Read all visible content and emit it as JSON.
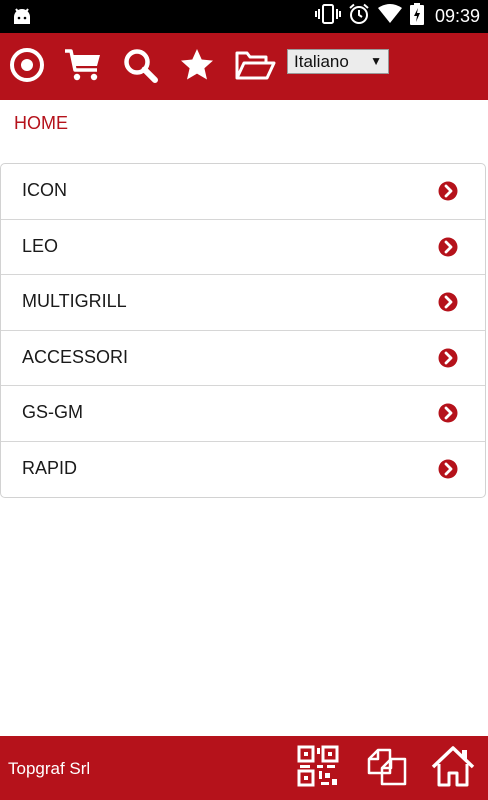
{
  "status_bar": {
    "time": "09:39",
    "icons": [
      "android-icon",
      "vibrate-icon",
      "alarm-icon",
      "wifi-icon",
      "battery-charging-icon"
    ]
  },
  "toolbar": {
    "icons": [
      "target-icon",
      "cart-icon",
      "search-icon",
      "star-icon",
      "folder-open-icon"
    ],
    "language": {
      "selected": "Italiano"
    }
  },
  "breadcrumb": {
    "home": "HOME"
  },
  "menu": {
    "items": [
      {
        "label": "ICON"
      },
      {
        "label": "LEO"
      },
      {
        "label": "MULTIGRILL"
      },
      {
        "label": "ACCESSORI"
      },
      {
        "label": "GS-GM"
      },
      {
        "label": "RAPID"
      }
    ],
    "chevron_icon": "chevron-circle-right-icon"
  },
  "footer": {
    "company": "Topgraf Srl",
    "icons": [
      "qr-code-icon",
      "copy-icon",
      "home-icon"
    ]
  },
  "colors": {
    "brand_red": "#b5121b",
    "text": "#1a1a1a",
    "divider": "#d6d6d6"
  }
}
